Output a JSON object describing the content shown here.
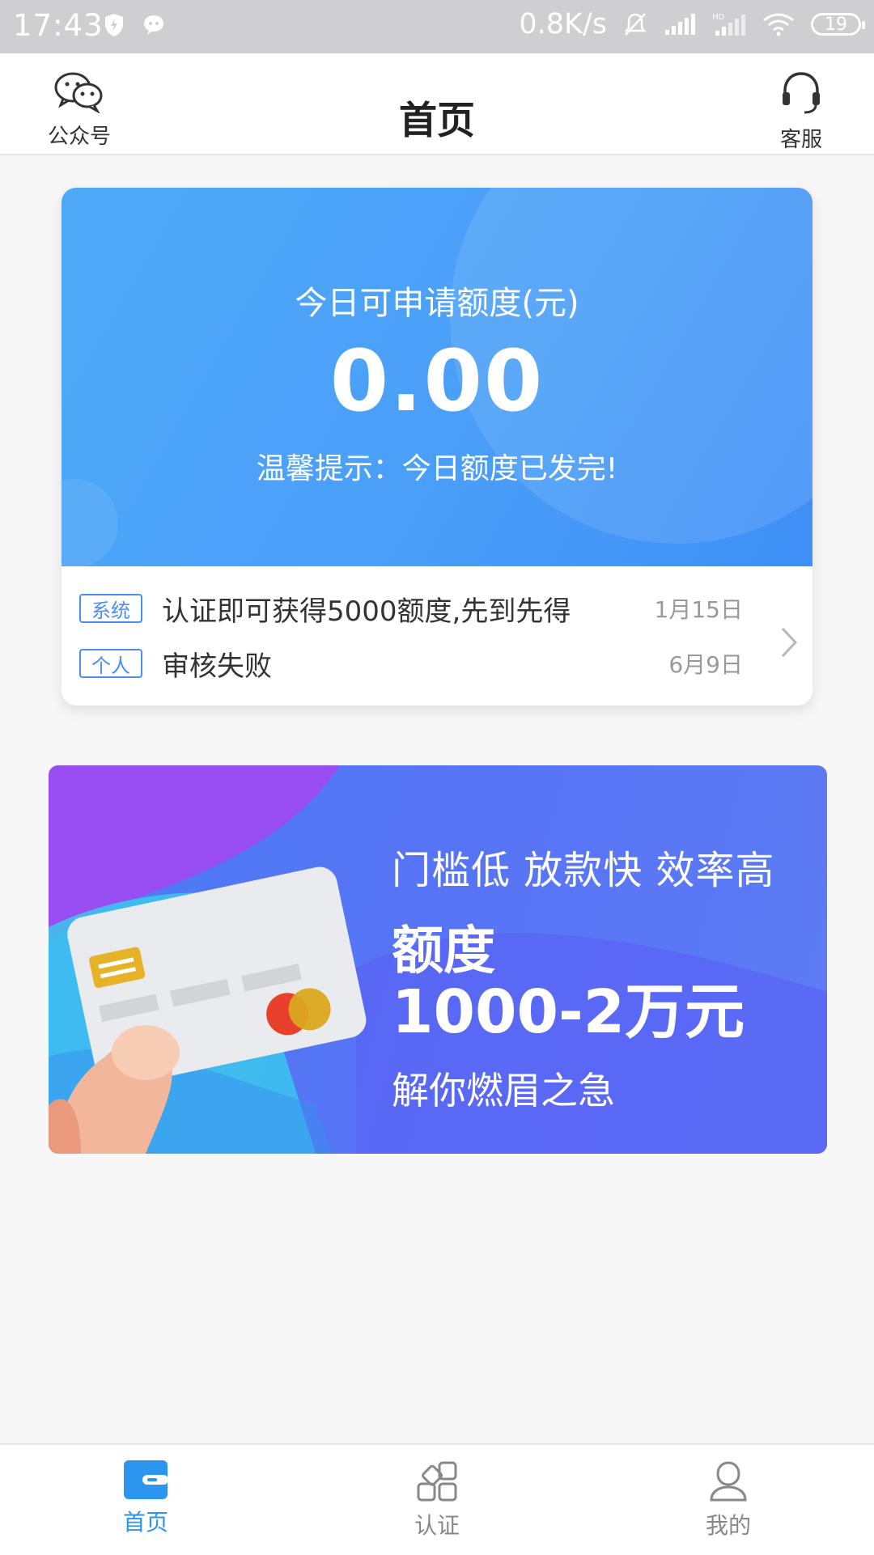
{
  "status_bar": {
    "time": "17:43",
    "net_speed": "0.8K/s",
    "battery": "19"
  },
  "header": {
    "title": "首页",
    "left_label": "公众号",
    "right_label": "客服"
  },
  "quota_card": {
    "label": "今日可申请额度(元)",
    "amount": "0.00",
    "tip": "温馨提示：今日额度已发完!"
  },
  "notices": [
    {
      "tag": "系统",
      "text": "认证即可获得5000额度,先到先得",
      "date": "1月15日"
    },
    {
      "tag": "个人",
      "text": "审核失败",
      "date": "6月9日"
    }
  ],
  "banner": {
    "slogan": "门槛低 放款快 效率高",
    "quota_title": "额度",
    "quota_range": "1000-2万元",
    "subtitle": "解你燃眉之急"
  },
  "tabs": [
    {
      "label": "首页",
      "icon": "wallet-icon",
      "active": true
    },
    {
      "label": "认证",
      "icon": "grid-icon",
      "active": false
    },
    {
      "label": "我的",
      "icon": "user-icon",
      "active": false
    }
  ],
  "colors": {
    "primary": "#2b95f0",
    "card_blue": "#4a9ff8",
    "banner_blue": "#5874f6",
    "tag_blue": "#4b8df0"
  }
}
